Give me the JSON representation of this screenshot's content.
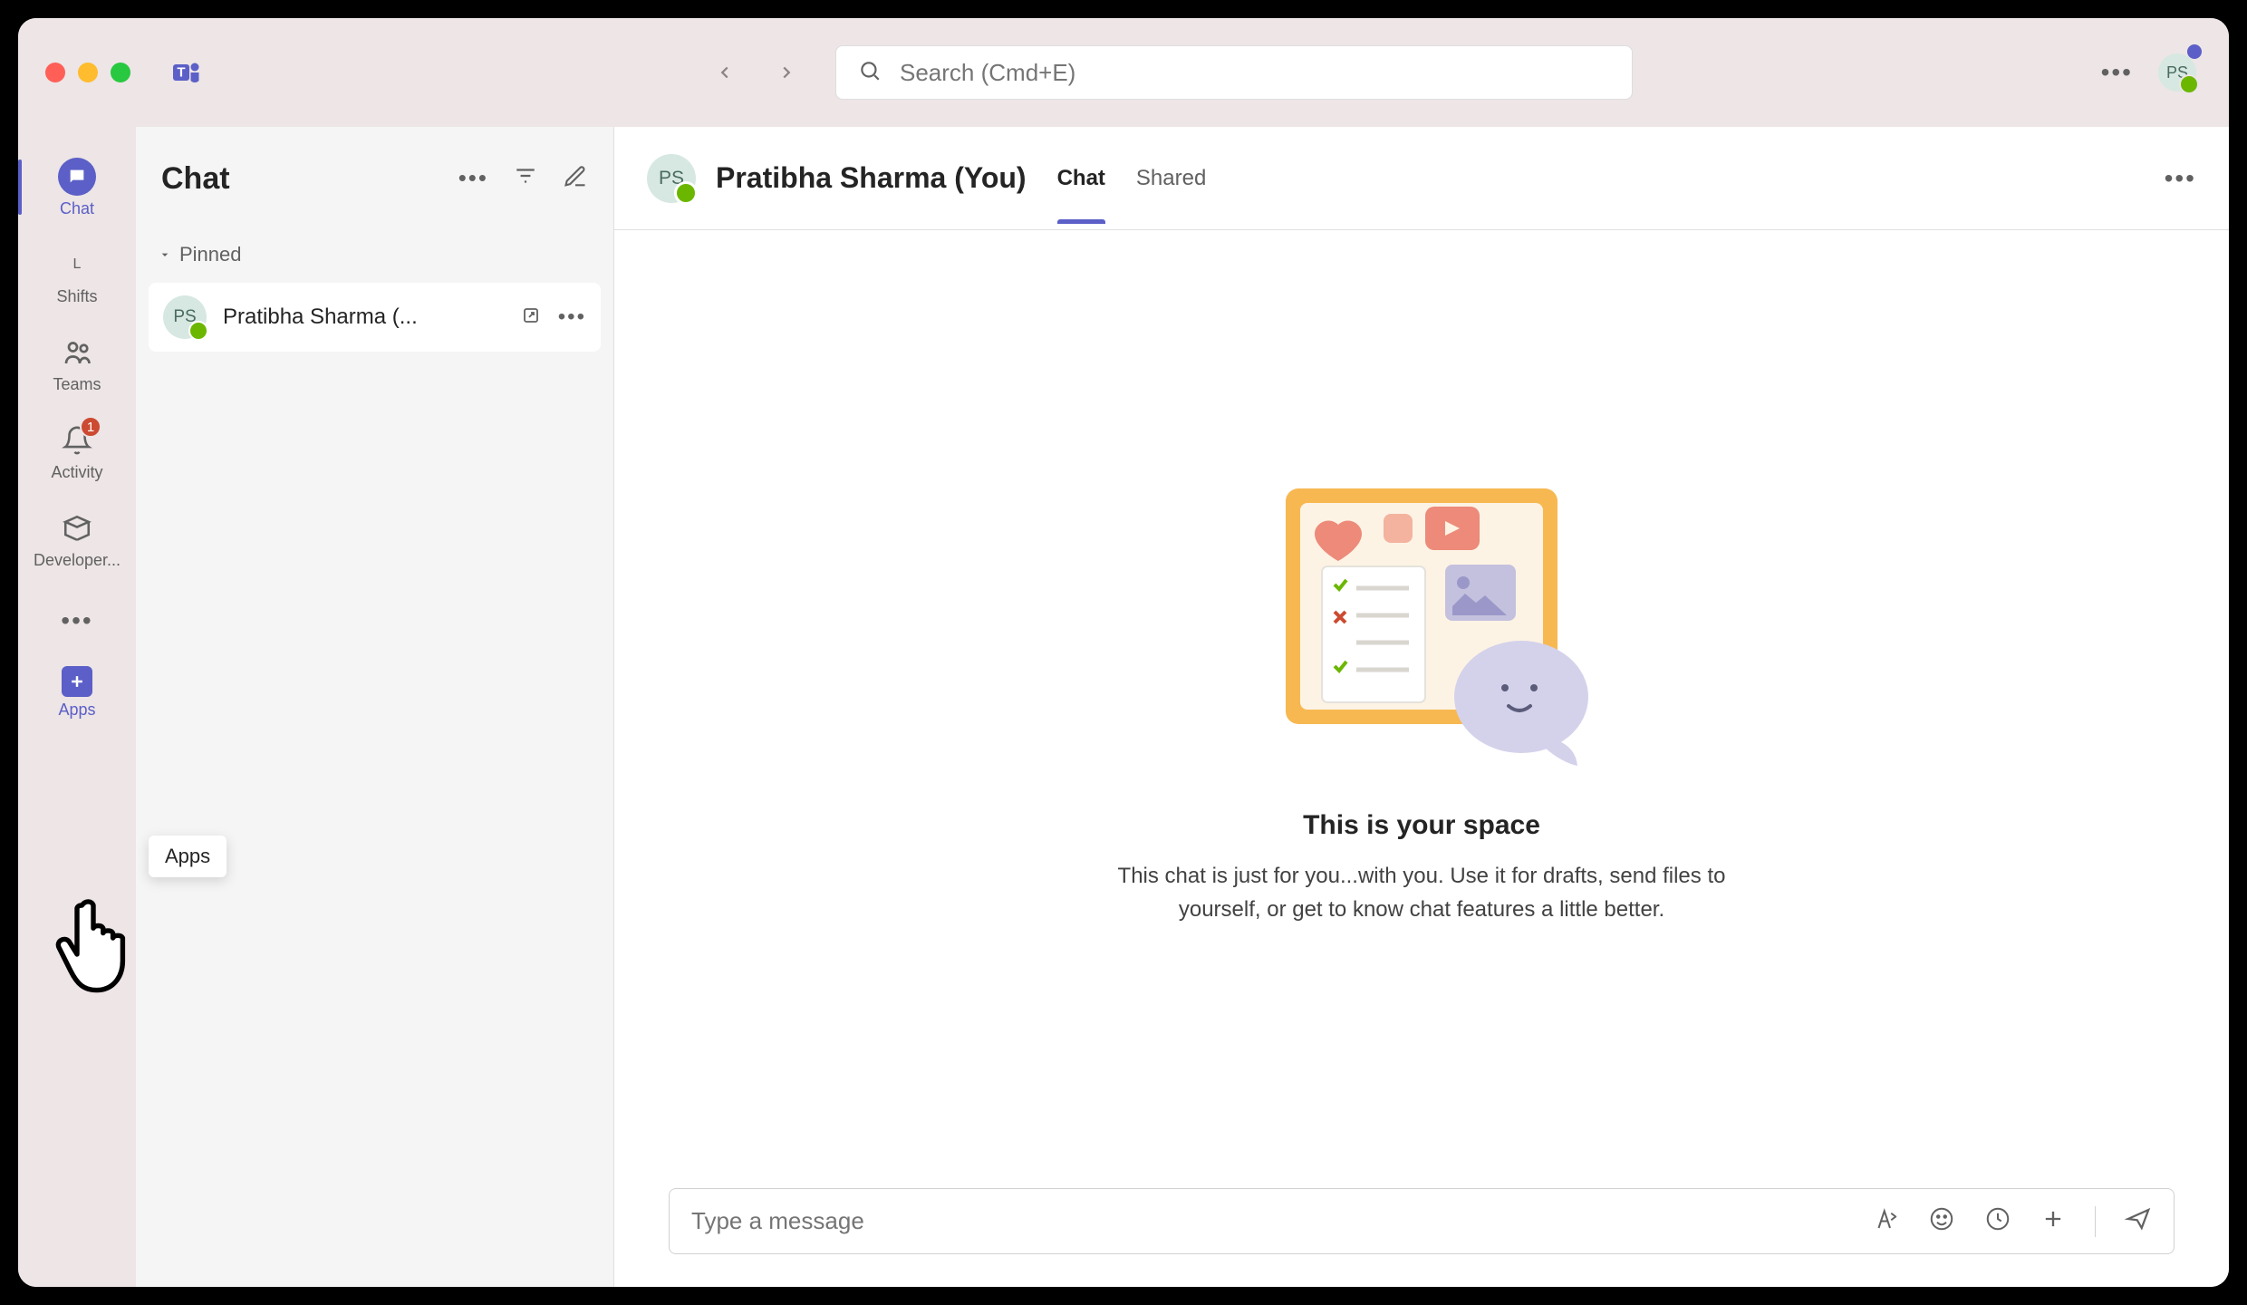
{
  "titlebar": {
    "search_placeholder": "Search (Cmd+E)",
    "avatar_initials": "PS"
  },
  "rail": {
    "items": [
      {
        "label": "Chat",
        "icon": "chat-icon",
        "active": true
      },
      {
        "label": "Shifts",
        "icon": "shifts-icon"
      },
      {
        "label": "Teams",
        "icon": "teams-icon"
      },
      {
        "label": "Activity",
        "icon": "activity-icon",
        "badge": "1"
      },
      {
        "label": "Developer...",
        "icon": "developer-icon"
      }
    ],
    "apps_label": "Apps",
    "tooltip": "Apps"
  },
  "chatlist": {
    "title": "Chat",
    "section_pinned": "Pinned",
    "items": [
      {
        "initials": "PS",
        "name": "Pratibha Sharma (..."
      }
    ]
  },
  "main": {
    "avatar_initials": "PS",
    "title": "Pratibha Sharma (You)",
    "tabs": [
      {
        "label": "Chat",
        "active": true
      },
      {
        "label": "Shared"
      }
    ],
    "empty": {
      "title": "This is your space",
      "desc": "This chat is just for you...with you. Use it for drafts, send files to yourself, or get to know chat features a little better."
    },
    "composer_placeholder": "Type a message"
  }
}
